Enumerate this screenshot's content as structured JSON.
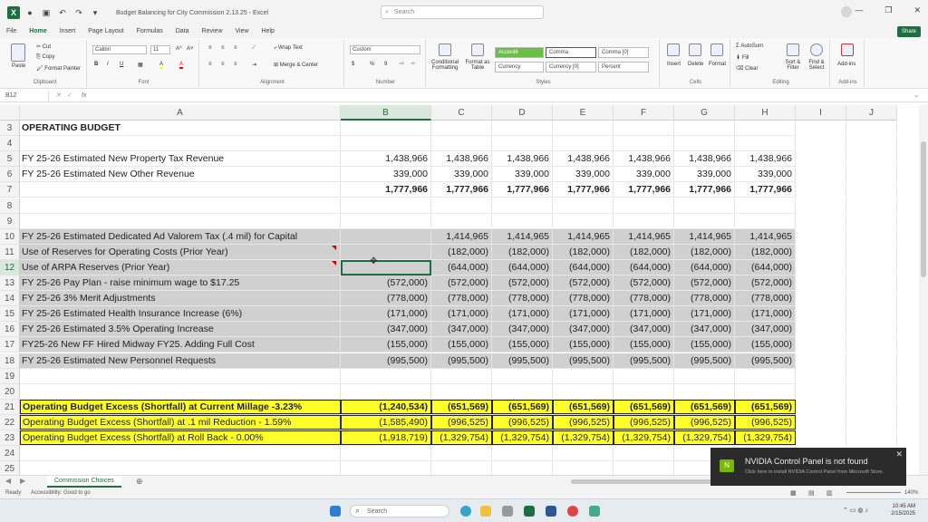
{
  "titlebar": {
    "doc_title": "Budget Balancing for City Commission 2.13.25  -  Excel",
    "search_placeholder": "Search",
    "excel_logo": "X"
  },
  "menu": [
    "File",
    "Home",
    "Insert",
    "Page Layout",
    "Formulas",
    "Data",
    "Review",
    "View",
    "Help"
  ],
  "share_label": "Share",
  "ribbon": {
    "paste": "Paste",
    "cut": "Cut",
    "copy": "Copy",
    "format_painter": "Format Painter",
    "clipboard": "Clipboard",
    "font_name": "Calibri",
    "font_size": "11",
    "font_grow": "A^",
    "font_shrink": "A˅",
    "bold_btn": "B",
    "italic_btn": "I",
    "underline_btn": "U",
    "fill_btn": "A",
    "font_color_btn": "A",
    "font": "Font",
    "wrap_text": "Wrap Text",
    "merge_center": "Merge & Center",
    "alignment": "Alignment",
    "number_format": "Custom",
    "currency_symbol": "$",
    "percent_symbol": "%",
    "comma_symbol": "9",
    "number": "Number",
    "conditional": "Conditional Formatting",
    "format_table": "Format as Table",
    "style_accent": "Accent6",
    "style_comma": "Comma",
    "style_comma0": "Comma [0]",
    "style_currency": "Currency",
    "style_currency0": "Currency [0]",
    "style_percent": "Percent",
    "styles": "Styles",
    "insert": "Insert",
    "delete": "Delete",
    "format": "Format",
    "cells": "Cells",
    "autosum": "AutoSum",
    "fill": "Fill",
    "clear": "Clear",
    "sort_filter": "Sort & Filter",
    "find_select": "Find & Select",
    "editing": "Editing",
    "addins": "Add-ins",
    "addins_group": "Add-ins"
  },
  "formula": {
    "namebox": "B12",
    "fx": "fx",
    "content": ""
  },
  "columns": [
    "A",
    "B",
    "C",
    "D",
    "E",
    "F",
    "G",
    "H",
    "I",
    "J"
  ],
  "rows": [
    {
      "num": "3",
      "label": "OPERATING BUDGET",
      "bold": true,
      "values": [
        "",
        "",
        "",
        "",
        "",
        "",
        ""
      ]
    },
    {
      "num": "4",
      "label": "",
      "values": [
        "",
        "",
        "",
        "",
        "",
        "",
        ""
      ]
    },
    {
      "num": "5",
      "label": "FY 25-26 Estimated New Property Tax Revenue",
      "values": [
        "1,438,966",
        "1,438,966",
        "1,438,966",
        "1,438,966",
        "1,438,966",
        "1,438,966",
        "1,438,966"
      ]
    },
    {
      "num": "6",
      "label": "FY 25-26 Estimated New Other Revenue",
      "values": [
        "339,000",
        "339,000",
        "339,000",
        "339,000",
        "339,000",
        "339,000",
        "339,000"
      ]
    },
    {
      "num": "7",
      "label": "",
      "bold": true,
      "values": [
        "1,777,966",
        "1,777,966",
        "1,777,966",
        "1,777,966",
        "1,777,966",
        "1,777,966",
        "1,777,966"
      ]
    },
    {
      "num": "8",
      "label": "",
      "values": [
        "",
        "",
        "",
        "",
        "",
        "",
        ""
      ]
    },
    {
      "num": "9",
      "label": "",
      "values": [
        "",
        "",
        "",
        "",
        "",
        "",
        ""
      ]
    },
    {
      "num": "10",
      "label": "FY 25-26 Estimated Dedicated Ad Valorem Tax (.4 mil) for Capital",
      "grey": true,
      "values": [
        "",
        "1,414,965",
        "1,414,965",
        "1,414,965",
        "1,414,965",
        "1,414,965",
        "1,414,965"
      ]
    },
    {
      "num": "11",
      "label": "Use of Reserves for Operating Costs (Prior Year)",
      "grey": true,
      "flag": true,
      "values": [
        "",
        "(182,000)",
        "(182,000)",
        "(182,000)",
        "(182,000)",
        "(182,000)",
        "(182,000)"
      ]
    },
    {
      "num": "12",
      "label": "Use of ARPA Reserves (Prior Year)",
      "grey": true,
      "flag": true,
      "values": [
        "",
        "(644,000)",
        "(644,000)",
        "(644,000)",
        "(644,000)",
        "(644,000)",
        "(644,000)"
      ]
    },
    {
      "num": "13",
      "label": "FY 25-26 Pay Plan - raise minimum wage to $17.25",
      "grey": true,
      "values": [
        "(572,000)",
        "(572,000)",
        "(572,000)",
        "(572,000)",
        "(572,000)",
        "(572,000)",
        "(572,000)"
      ]
    },
    {
      "num": "14",
      "label": "FY 25-26 3% Merit Adjustments",
      "grey": true,
      "values": [
        "(778,000)",
        "(778,000)",
        "(778,000)",
        "(778,000)",
        "(778,000)",
        "(778,000)",
        "(778,000)"
      ]
    },
    {
      "num": "15",
      "label": "FY 25-26 Estimated Health Insurance Increase (6%)",
      "grey": true,
      "values": [
        "(171,000)",
        "(171,000)",
        "(171,000)",
        "(171,000)",
        "(171,000)",
        "(171,000)",
        "(171,000)"
      ]
    },
    {
      "num": "16",
      "label": "FY 25-26 Estimated 3.5% Operating Increase",
      "grey": true,
      "values": [
        "(347,000)",
        "(347,000)",
        "(347,000)",
        "(347,000)",
        "(347,000)",
        "(347,000)",
        "(347,000)"
      ]
    },
    {
      "num": "17",
      "label": "FY25-26 New FF Hired Midway FY25. Adding Full Cost",
      "grey": true,
      "values": [
        "(155,000)",
        "(155,000)",
        "(155,000)",
        "(155,000)",
        "(155,000)",
        "(155,000)",
        "(155,000)"
      ]
    },
    {
      "num": "18",
      "label": "FY 25-26 Estimated New Personnel Requests",
      "grey": true,
      "values": [
        "(995,500)",
        "(995,500)",
        "(995,500)",
        "(995,500)",
        "(995,500)",
        "(995,500)",
        "(995,500)"
      ]
    },
    {
      "num": "19",
      "label": "",
      "values": [
        "",
        "",
        "",
        "",
        "",
        "",
        ""
      ]
    },
    {
      "num": "20",
      "label": "",
      "values": [
        "",
        "",
        "",
        "",
        "",
        "",
        ""
      ]
    },
    {
      "num": "21",
      "label": "Operating Budget Excess (Shortfall) at Current Millage -3.23%",
      "bold": true,
      "yellow": true,
      "values": [
        "(1,240,534)",
        "(651,569)",
        "(651,569)",
        "(651,569)",
        "(651,569)",
        "(651,569)",
        "(651,569)"
      ]
    },
    {
      "num": "22",
      "label": "Operating Budget Excess (Shortfall) at .1 mil Reduction - 1.59%",
      "yellow": true,
      "values": [
        "(1,585,490)",
        "(996,525)",
        "(996,525)",
        "(996,525)",
        "(996,525)",
        "(996,525)",
        "(996,525)"
      ]
    },
    {
      "num": "23",
      "label": "Operating Budget Excess (Shortfall) at Roll Back - 0.00%",
      "yellow": true,
      "values": [
        "(1,918,719)",
        "(1,329,754)",
        "(1,329,754)",
        "(1,329,754)",
        "(1,329,754)",
        "(1,329,754)",
        "(1,329,754)"
      ]
    },
    {
      "num": "24",
      "label": "",
      "values": [
        "",
        "",
        "",
        "",
        "",
        "",
        ""
      ]
    },
    {
      "num": "25",
      "label": "",
      "values": [
        "",
        "",
        "",
        "",
        "",
        "",
        ""
      ]
    }
  ],
  "sheet_tab": "Commission Choices",
  "status": {
    "ready": "Ready",
    "accessibility": "Accessibility: Good to go",
    "zoom": "140%"
  },
  "taskbar": {
    "search": "Search",
    "time": "10:45 AM",
    "date": "2/15/2025"
  },
  "toast": {
    "title": "NVIDIA Control Panel is not found",
    "body": "Click here to install NVIDIA Control Panel from Microsoft Store.",
    "icon": "N"
  },
  "colors": {
    "excel_green": "#1d6f42",
    "highlight_yellow": "#ffff2a",
    "input_grey": "#d0d0d0"
  }
}
